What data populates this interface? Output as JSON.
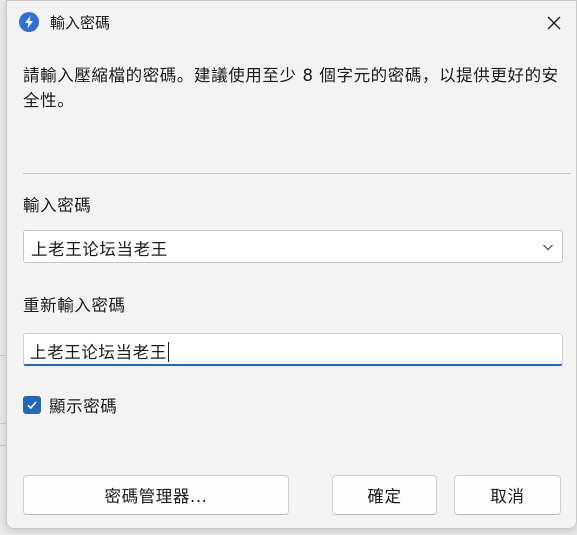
{
  "window": {
    "title": "輸入密碼",
    "app_icon": "lightning-app-icon",
    "close_icon": "close-icon"
  },
  "description": "請輸入壓縮檔的密碼。建議使用至少 8 個字元的密碼，以提供更好的安全性。",
  "password": {
    "label": "輸入密碼",
    "value": "上老王论坛当老王",
    "dropdown_icon": "chevron-down-icon"
  },
  "confirm": {
    "label": "重新輸入密碼",
    "value": "上老王论坛当老王"
  },
  "show_password": {
    "label": "顯示密碼",
    "checked": true
  },
  "buttons": {
    "manager": "密碼管理器...",
    "ok": "確定",
    "cancel": "取消"
  },
  "colors": {
    "accent": "#2467b8",
    "app_icon": "#2f6fd6"
  }
}
